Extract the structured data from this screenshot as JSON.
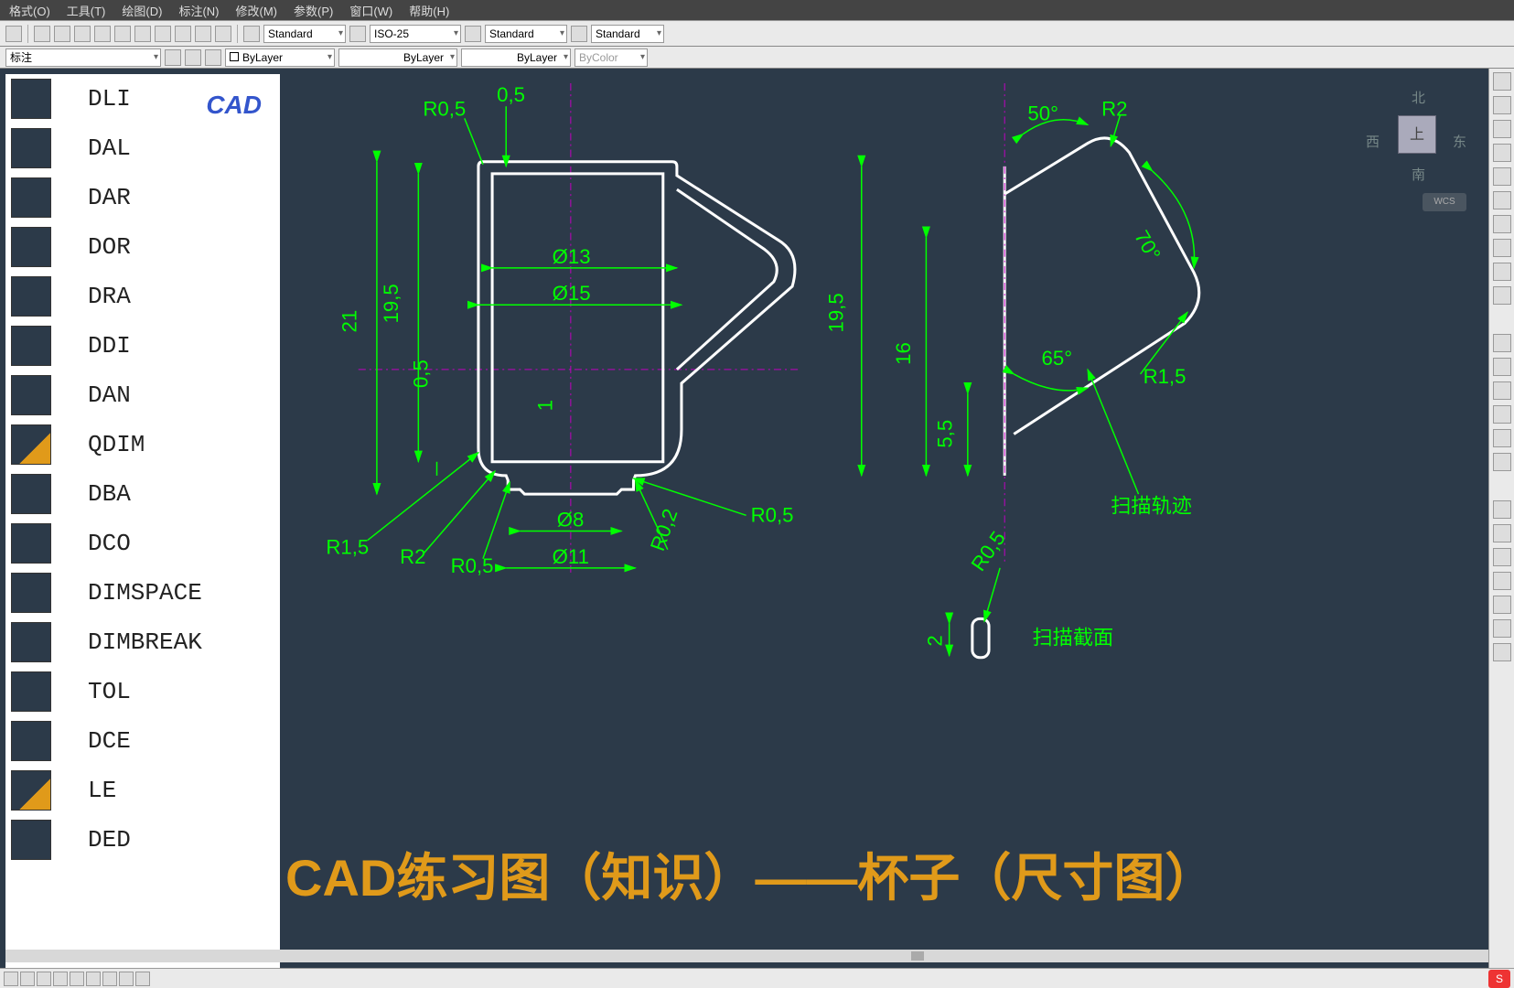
{
  "menu": [
    "格式(O)",
    "工具(T)",
    "绘图(D)",
    "标注(N)",
    "修改(M)",
    "参数(P)",
    "窗口(W)",
    "帮助(H)"
  ],
  "tb1": {
    "style": "Standard",
    "dimstyle": "ISO-25",
    "tstyle": "Standard",
    "mlstyle": "Standard"
  },
  "tb2": {
    "layer": "标注",
    "color": "ByLayer",
    "ltype": "ByLayer",
    "lweight": "ByLayer",
    "plot": "ByColor"
  },
  "panel": [
    {
      "cmd": "DLI"
    },
    {
      "cmd": "DAL"
    },
    {
      "cmd": "DAR"
    },
    {
      "cmd": "DOR"
    },
    {
      "cmd": "DRA"
    },
    {
      "cmd": "DDI"
    },
    {
      "cmd": "DAN"
    },
    {
      "cmd": "QDIM"
    },
    {
      "cmd": "DBA"
    },
    {
      "cmd": "DCO"
    },
    {
      "cmd": "DIMSPACE"
    },
    {
      "cmd": "DIMBREAK"
    },
    {
      "cmd": "TOL"
    },
    {
      "cmd": "DCE"
    },
    {
      "cmd": "LE"
    },
    {
      "cmd": "DED"
    }
  ],
  "brand": "CAD",
  "dims": {
    "d21": "21",
    "d195": "19,5",
    "r05a": "R0,5",
    "t05": "0,5",
    "d13": "Ø13",
    "d15": "Ø15",
    "v05": "0,5",
    "v1": "1",
    "d8": "Ø8",
    "d11": "Ø11",
    "r15": "R1,5",
    "r2": "R2",
    "r05b": "R0,5",
    "r02": "R0,2",
    "r05c": "R0,5",
    "a50": "50°",
    "r2b": "R2",
    "a70": "70°",
    "a65": "65°",
    "r15b": "R1,5",
    "d195b": "19,5",
    "d16": "16",
    "d55": "5,5",
    "scan1": "扫描轨迹",
    "r05d": "R0,5",
    "d2": "2",
    "scan2": "扫描截面"
  },
  "cube": {
    "n": "北",
    "s": "南",
    "e": "东",
    "w": "西",
    "u": "上",
    "wcs": "WCS"
  },
  "title": "CAD练习图（知识）——杯子（尺寸图）"
}
